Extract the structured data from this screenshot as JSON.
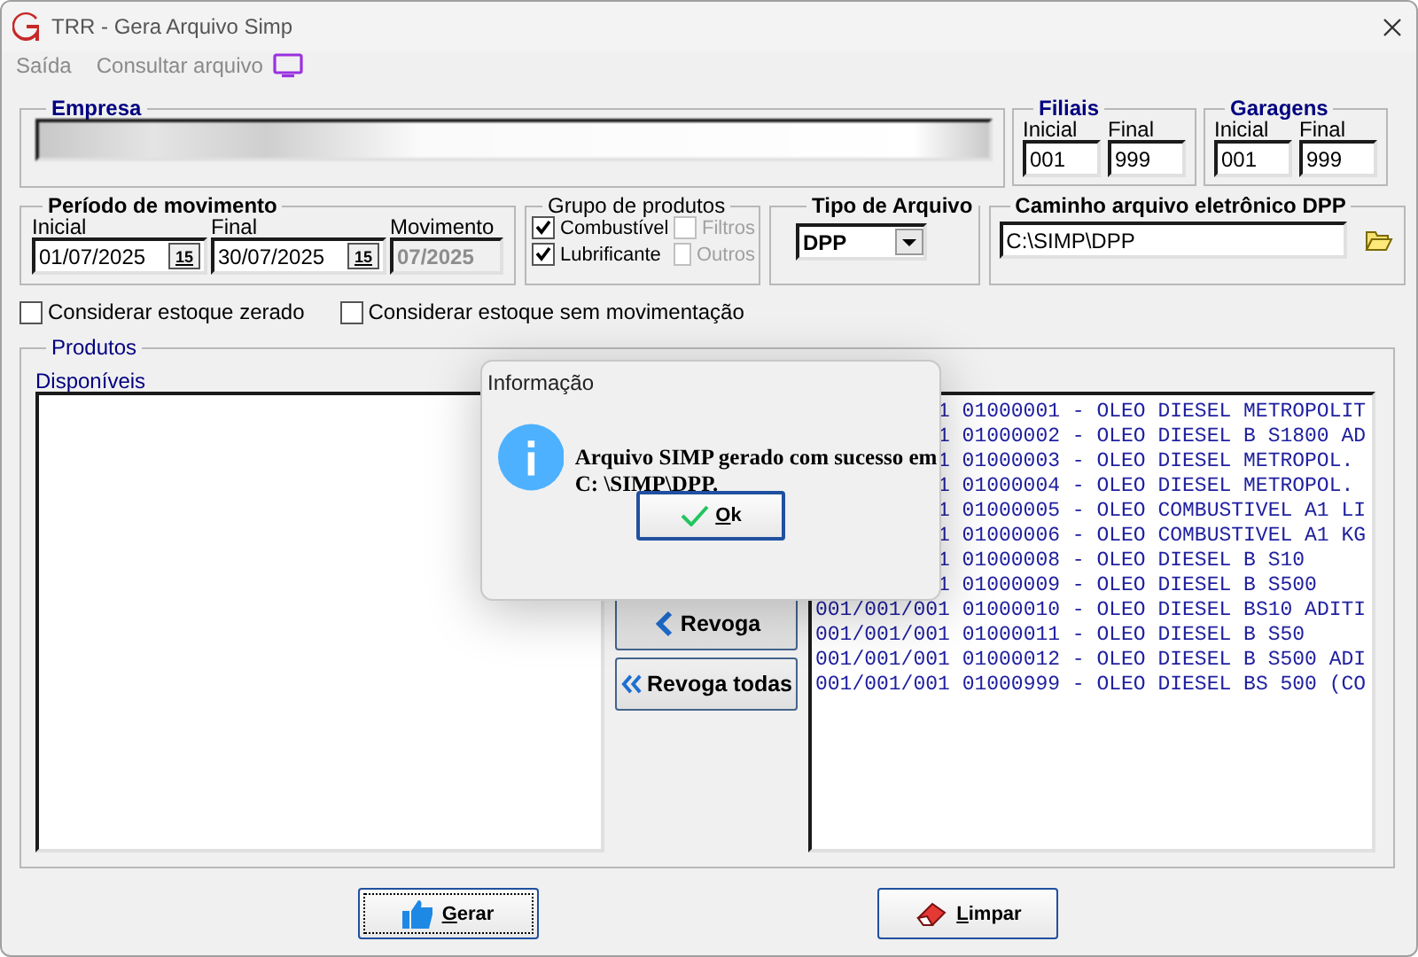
{
  "window": {
    "title": "TRR - Gera Arquivo Simp"
  },
  "menu": [
    {
      "label": "Saída"
    },
    {
      "label": "Consultar arquivo"
    }
  ],
  "empresa": {
    "label": "Empresa"
  },
  "filiais": {
    "label": "Filiais",
    "fields": [
      {
        "label": "Inicial",
        "value": "001"
      },
      {
        "label": "Final",
        "value": "999"
      }
    ]
  },
  "garagens": {
    "label": "Garagens",
    "fields": [
      {
        "label": "Inicial",
        "value": "001"
      },
      {
        "label": "Final",
        "value": "999"
      }
    ]
  },
  "periodo": {
    "label": "Período de movimento",
    "dates": [
      {
        "label": "Inicial",
        "value": "01/07/2025",
        "icon_text": "15"
      },
      {
        "label": "Final",
        "value": "30/07/2025",
        "icon_text": "15"
      }
    ],
    "movimento": {
      "label": "Movimento",
      "value": "07/2025",
      "disabled": true
    }
  },
  "grupo": {
    "label": "Grupo de produtos",
    "options": [
      {
        "label": "Combustível",
        "checked": true,
        "disabled": false
      },
      {
        "label": "Filtros",
        "checked": false,
        "disabled": true
      },
      {
        "label": "Lubrificante",
        "checked": true,
        "disabled": false
      },
      {
        "label": "Outros",
        "checked": false,
        "disabled": true
      }
    ]
  },
  "tipo": {
    "label": "Tipo de Arquivo",
    "value": "DPP"
  },
  "caminho": {
    "label": "Caminho arquivo eletrônico DPP",
    "value": "C:\\SIMP\\DPP"
  },
  "options": [
    {
      "label": "Considerar estoque zerado",
      "checked": false
    },
    {
      "label": "Considerar estoque sem movimentação",
      "checked": false
    }
  ],
  "produtos": {
    "label": "Produtos",
    "available_label": "Disponíveis",
    "buttons": [
      {
        "label": "Revoga",
        "kind": "single"
      },
      {
        "label": "Revoga todas",
        "kind": "all"
      }
    ],
    "selected_items": [
      {
        "text": "1 01000001 - OLEO DIESEL METROPOLIT",
        "covered": true
      },
      {
        "text": "1 01000002 - OLEO DIESEL B S1800 AD",
        "covered": true
      },
      {
        "text": "1 01000003 - OLEO DIESEL METROPOL.",
        "covered": true
      },
      {
        "text": "1 01000004 - OLEO DIESEL METROPOL.",
        "covered": true
      },
      {
        "text": "1 01000005 - OLEO COMBUSTIVEL A1 LI",
        "covered": true
      },
      {
        "text": "1 01000006 - OLEO COMBUSTIVEL A1 KG",
        "covered": true
      },
      {
        "text": "1 01000008 - OLEO DIESEL B S10",
        "covered": true
      },
      {
        "text": "1 01000009 - OLEO DIESEL B S500",
        "covered": true
      },
      {
        "text": "001/001/001 01000010 - OLEO DIESEL BS10 ADITI",
        "covered": false
      },
      {
        "text": "001/001/001 01000011 - OLEO DIESEL B S50",
        "covered": false
      },
      {
        "text": "001/001/001 01000012 - OLEO DIESEL B S500 ADI",
        "covered": false
      },
      {
        "text": "001/001/001 01000999 - OLEO DIESEL BS 500 (CO",
        "covered": false
      }
    ]
  },
  "actions": [
    {
      "label": "Gerar",
      "kind": "generate",
      "underline_first": true
    },
    {
      "label": "Limpar",
      "kind": "clear",
      "underline_first": true
    }
  ],
  "dialog": {
    "title": "Informação",
    "message": "Arquivo SIMP gerado com sucesso em C: \\SIMP\\DPP.",
    "button": {
      "label": "Ok",
      "underline_first": true
    }
  }
}
